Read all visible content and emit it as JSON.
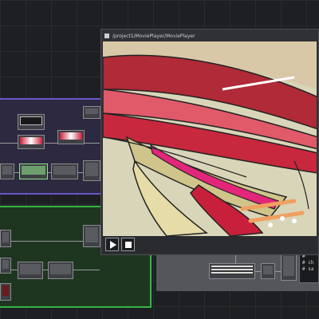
{
  "viewer": {
    "path": "/project1/MoviePlayer/MoviePlayer",
    "play_icon": "play-icon",
    "stop_icon": "stop-icon"
  },
  "dat_lines": [
    "#",
    "# ch",
    "# sa"
  ],
  "colors": {
    "background": "#1e1f22",
    "purple_comp": "#6a56c8",
    "green_comp": "#38b245",
    "gray_comp": "#555659"
  }
}
